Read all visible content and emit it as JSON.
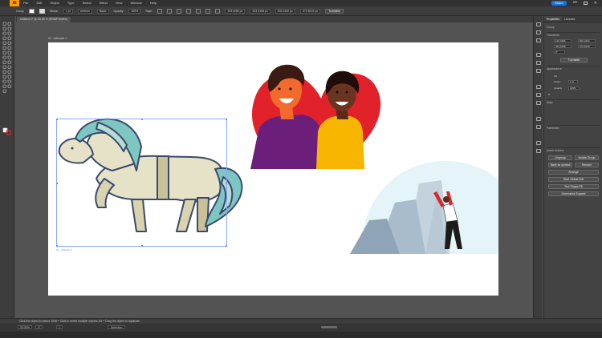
{
  "menubar": {
    "logo": "Ai",
    "items": [
      "File",
      "Edit",
      "Object",
      "Type",
      "Select",
      "Effect",
      "View",
      "Window",
      "Help"
    ],
    "share_label": "Share"
  },
  "controlbar": {
    "group_label": "Group",
    "stroke_label": "Stroke:",
    "stroke_value": "1 pt",
    "stroke_style": "Uniform",
    "brush_value": "Basic",
    "opacity_label": "Opacity:",
    "opacity_value": "100%",
    "style_label": "Style:",
    "x_value": "193.4256 px",
    "y_value": "443.3198 px",
    "w_value": "502.2432 px",
    "h_value": "372.8123 px",
    "turnable_label": "Turntable"
  },
  "document": {
    "tab_title": "Untitled-1* @ 33.33 % (RGB/Preview)",
    "artboard_label": "01 - Artboard 1",
    "selection_label": "01 - Artboard 1"
  },
  "properties": {
    "tabs": [
      "Properties",
      "Libraries"
    ],
    "group_title": "Group",
    "transform_title": "Transform",
    "x_field": "193.4256",
    "y_field": "443.3198",
    "w_field": "502.2432",
    "h_field": "372.8123",
    "angle_field": "0°",
    "turntable_label": "Turntable",
    "appearance_title": "Appearance",
    "fill_label": "Fill",
    "stroke_label": "Stroke",
    "stroke_value": "1 pt",
    "opacity_label": "Opacity",
    "opacity_value": "100%",
    "fx_label": "fx",
    "align_title": "Align",
    "pathfinder_title": "Pathfinder",
    "quick_actions_title": "Quick Actions",
    "ungroup_label": "Ungroup",
    "isolate_label": "Isolate Group",
    "save_symbol_label": "Save as symbol",
    "recolor_label": "Recolor",
    "arrange_label": "Arrange",
    "start_global_edit_label": "Start Global Edit",
    "text_3d_label": "Text Shape Fill",
    "generative_expand_label": "Generative Expand"
  },
  "status": {
    "hint": "Click the object to select.  Shift + Click to select multiple objects.  Alt + Drag the object to duplicate.",
    "zoom": "33.33%",
    "angle": "0°",
    "page_label": "1",
    "mode": "Selection"
  },
  "colors": {
    "heart": "#e2222a",
    "purple_shirt": "#6b1f7a",
    "yellow_shirt": "#f7b500",
    "skin_dark": "#3a1a12",
    "skin_orange": "#f26a2e",
    "horse_body": "#e6e2c7",
    "horse_mane": "#7ec6c1",
    "horse_outline": "#3a4a6b",
    "rock": "#a9bccb",
    "sky_circle": "#e5f4f8"
  }
}
